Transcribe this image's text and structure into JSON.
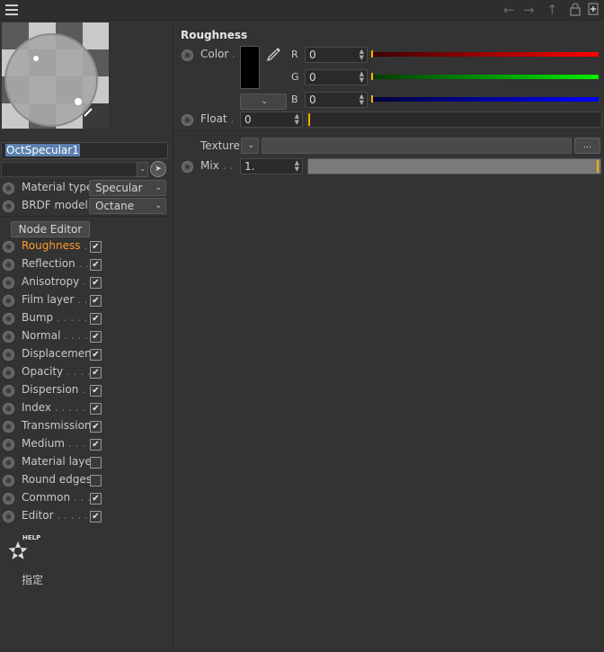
{
  "topbar": {
    "back_icon": "arrow-left-icon",
    "forward_icon": "arrow-right-icon",
    "up_icon": "arrow-up-icon",
    "lock_icon": "lock-icon",
    "new_icon": "new-window-icon"
  },
  "left": {
    "material_name": "OctSpecular1",
    "material_type": {
      "label": "Material type",
      "value": "Specular"
    },
    "brdf_model": {
      "label": "BRDF model",
      "value": "Octane"
    },
    "node_editor_label": "Node Editor",
    "channels": [
      {
        "label": "Roughness",
        "dots": " . .",
        "checked": true,
        "active": true
      },
      {
        "label": "Reflection",
        "dots": " . .",
        "checked": true,
        "active": false
      },
      {
        "label": "Anisotropy",
        "dots": " .",
        "checked": true,
        "active": false
      },
      {
        "label": "Film layer",
        "dots": " . .",
        "checked": true,
        "active": false
      },
      {
        "label": "Bump",
        "dots": " . . . . .",
        "checked": true,
        "active": false
      },
      {
        "label": "Normal",
        "dots": " . . . .",
        "checked": true,
        "active": false
      },
      {
        "label": "Displacement",
        "dots": "",
        "checked": true,
        "active": false
      },
      {
        "label": "Opacity",
        "dots": " . . . .",
        "checked": true,
        "active": false
      },
      {
        "label": "Dispersion",
        "dots": " . .",
        "checked": true,
        "active": false
      },
      {
        "label": "Index",
        "dots": " . . . . . .",
        "checked": true,
        "active": false
      },
      {
        "label": "Transmission",
        "dots": "",
        "checked": true,
        "active": false
      },
      {
        "label": "Medium",
        "dots": " . . . .",
        "checked": true,
        "active": false
      },
      {
        "label": "Material layer",
        "dots": "",
        "checked": false,
        "active": false
      },
      {
        "label": "Round edges",
        "dots": "",
        "checked": false,
        "active": false
      },
      {
        "label": "Common",
        "dots": " . . .",
        "checked": true,
        "active": false
      },
      {
        "label": "Editor",
        "dots": " . . . . .",
        "checked": true,
        "active": false
      }
    ],
    "help_badge": "HELP",
    "assign_label": "指定"
  },
  "right": {
    "section_title": "Roughness",
    "color_label": "Color",
    "color_dots": " .",
    "swatch_color": "#000000",
    "r_label": "R",
    "r_value": "0",
    "g_label": "G",
    "g_value": "0",
    "b_label": "B",
    "b_value": "0",
    "float_label": "Float",
    "float_dots": " .",
    "float_value": "0",
    "texture_label": "Texture",
    "texture_more": "...",
    "mix_label": "Mix",
    "mix_dots": " . .",
    "mix_value": "1.",
    "accent_color": "#ffa500"
  }
}
